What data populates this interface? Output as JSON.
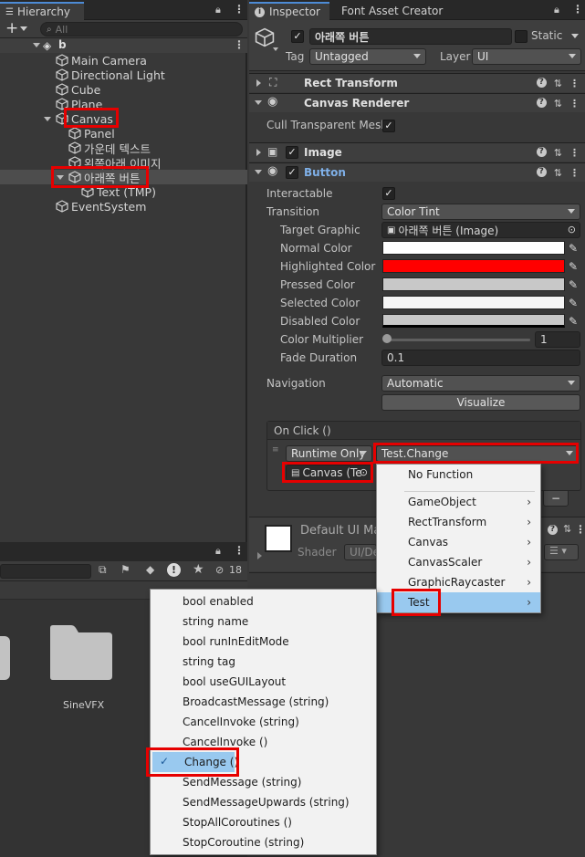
{
  "hierarchy": {
    "tab_label": "Hierarchy",
    "search_placeholder": "All",
    "scene_name": "b",
    "items": [
      "Main Camera",
      "Directional Light",
      "Cube",
      "Plane",
      "Canvas",
      "Panel",
      "가운데 텍스트",
      "왼쪽아래 이미지",
      "아래쪽 버튼",
      "Text (TMP)",
      "EventSystem"
    ]
  },
  "inspector": {
    "tab_label": "Inspector",
    "tab2_label": "Font Asset Creator",
    "object_name": "아래쪽 버튼",
    "static_label": "Static",
    "tag_label": "Tag",
    "tag_value": "Untagged",
    "layer_label": "Layer",
    "layer_value": "UI",
    "components": {
      "rect_transform": "Rect Transform",
      "canvas_renderer": "Canvas Renderer",
      "cull_label": "Cull Transparent Mesh",
      "image": "Image",
      "button": "Button"
    },
    "button": {
      "interactable_label": "Interactable",
      "transition_label": "Transition",
      "transition_value": "Color Tint",
      "target_graphic_label": "Target Graphic",
      "target_graphic_value": "아래쪽 버튼 (Image)",
      "normal_color_label": "Normal Color",
      "highlighted_color_label": "Highlighted Color",
      "pressed_color_label": "Pressed Color",
      "selected_color_label": "Selected Color",
      "disabled_color_label": "Disabled Color",
      "color_multiplier_label": "Color Multiplier",
      "color_multiplier_value": "1",
      "fade_duration_label": "Fade Duration",
      "fade_duration_value": "0.1",
      "navigation_label": "Navigation",
      "navigation_value": "Automatic",
      "visualize_label": "Visualize",
      "onclick_label": "On Click ()",
      "runtime_value": "Runtime Only",
      "function_value": "Test.Change",
      "object_value": "Canvas (Te",
      "minus_label": "−"
    },
    "material": {
      "name": "Default UI Ma",
      "shader_label": "Shader",
      "shader_value": "UI/De"
    }
  },
  "project": {
    "hidden_count": "18",
    "folder_name": "SineVFX"
  },
  "function_menu": {
    "items": [
      "No Function",
      "GameObject",
      "RectTransform",
      "Canvas",
      "CanvasScaler",
      "GraphicRaycaster",
      "Test"
    ]
  },
  "method_menu": {
    "items": [
      "bool enabled",
      "string name",
      "bool runInEditMode",
      "string tag",
      "bool useGUILayout",
      "BroadcastMessage (string)",
      "CancelInvoke (string)",
      "CancelInvoke ()",
      "Change ()",
      "SendMessage (string)",
      "SendMessageUpwards (string)",
      "StopAllCoroutines ()",
      "StopCoroutine (string)"
    ],
    "check_mark": "✓"
  },
  "colors": {
    "highlight_red": "#e60000",
    "highlighted_color": "#ff0000",
    "menu_selection": "#99c9ef",
    "tab_accent": "#4d8bd6"
  }
}
